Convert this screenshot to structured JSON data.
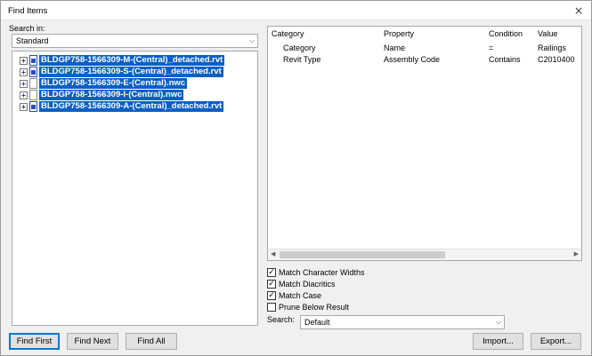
{
  "window": {
    "title": "Find Items"
  },
  "left": {
    "search_in_label": "Search in:",
    "search_in_value": "Standard",
    "tree": [
      {
        "label": "BLDGP758-1566309-M-(Central)_detached.rvt",
        "icon": "revit-file-icon"
      },
      {
        "label": "BLDGP758-1566309-S-(Central)_detached.rvt",
        "icon": "revit-file-icon"
      },
      {
        "label": "BLDGP758-1566309-E-(Central).nwc",
        "icon": "nwc-file-icon"
      },
      {
        "label": "BLDGP758-1566309-I-(Central).nwc",
        "icon": "nwc-file-icon"
      },
      {
        "label": "BLDGP758-1566309-A-(Central)_detached.rvt",
        "icon": "revit-file-icon"
      }
    ]
  },
  "grid": {
    "columns": [
      "Category",
      "Property",
      "Condition",
      "Value"
    ],
    "rows": [
      [
        "Category",
        "Name",
        "=",
        "Railings"
      ],
      [
        "Revit Type",
        "Assembly Code",
        "Contains",
        "C2010400"
      ]
    ]
  },
  "options": [
    {
      "label": "Match Character Widths",
      "checked": true
    },
    {
      "label": "Match Diacritics",
      "checked": true
    },
    {
      "label": "Match Case",
      "checked": true
    },
    {
      "label": "Prune Below Result",
      "checked": false
    }
  ],
  "search": {
    "label": "Search:",
    "value": "Default"
  },
  "buttons": {
    "find_first": "Find First",
    "find_next": "Find Next",
    "find_all": "Find All",
    "import": "Import...",
    "export": "Export..."
  },
  "icons": {
    "close": "×",
    "dropdown": "⌵",
    "expand": "+",
    "check": "✓"
  },
  "colors": {
    "selection": "#0a5fc7",
    "default_button_border": "#0078d7"
  }
}
